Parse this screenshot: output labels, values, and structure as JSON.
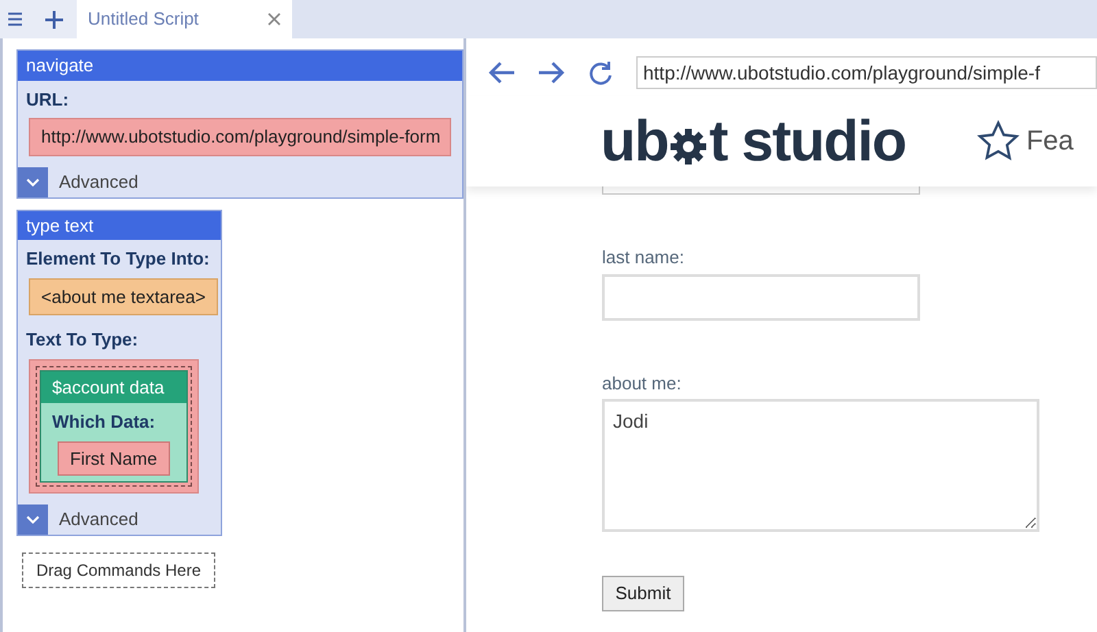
{
  "tabs": [
    {
      "label": "Untitled Script",
      "selected": true
    }
  ],
  "commands": [
    {
      "kind": "navigate",
      "title": "navigate",
      "fields": [
        {
          "label": "URL:",
          "kind": "text",
          "value": "http://www.ubotstudio.com/playground/simple-form"
        }
      ],
      "advanced": "Advanced"
    },
    {
      "kind": "type_text",
      "title": "type text",
      "fields": [
        {
          "label": "Element To Type Into:",
          "kind": "element",
          "value": "<about me textarea>"
        },
        {
          "label": "Text To Type:",
          "kind": "function",
          "title": "$account data",
          "param_label": "Which Data:",
          "value": "First Name"
        }
      ],
      "advanced": "Advanced"
    }
  ],
  "drop_zone": "Drag Commands Here",
  "browser": {
    "address": "http://www.ubotstudio.com/playground/simple-f",
    "logo": {
      "before": "ub",
      "after": "t studio"
    },
    "nav_item": "Fea",
    "form": [
      {
        "kind": "input",
        "label": "last name:"
      },
      {
        "kind": "textarea",
        "label": "about me:",
        "value": "Jodi"
      }
    ],
    "submit": "Submit"
  }
}
